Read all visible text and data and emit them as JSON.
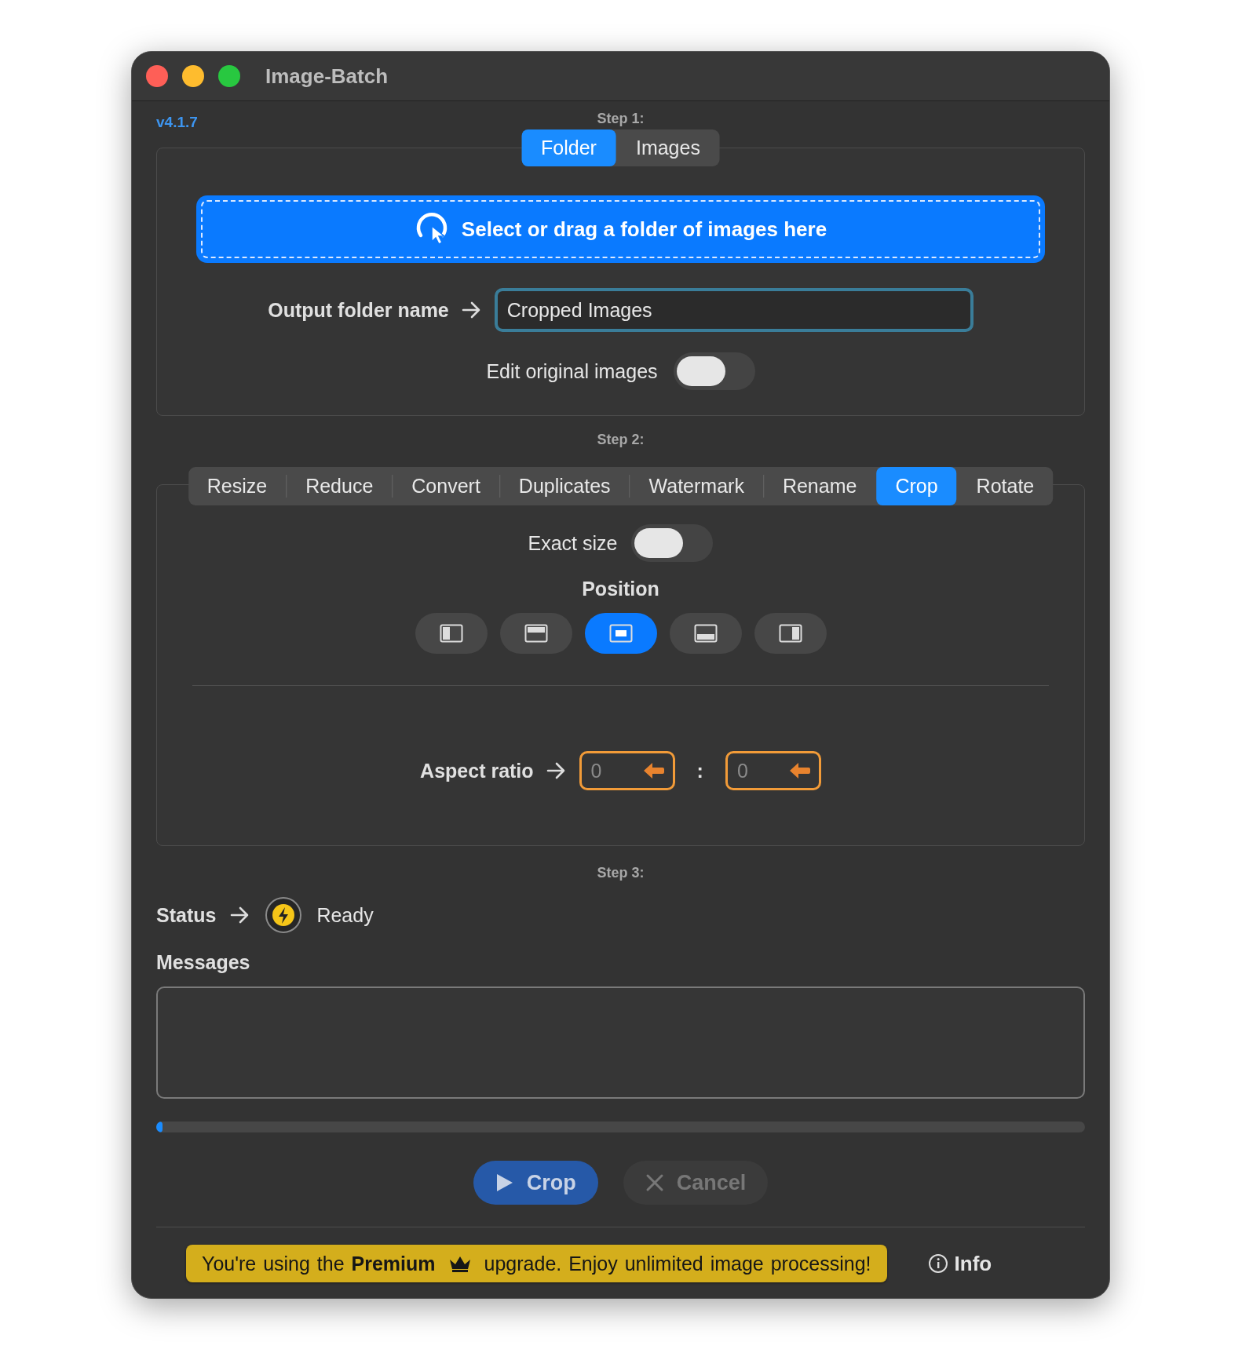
{
  "window": {
    "title": "Image-Batch"
  },
  "version": "v4.1.7",
  "step1": {
    "label": "Step 1:",
    "source_tabs": [
      {
        "label": "Folder",
        "selected": true
      },
      {
        "label": "Images",
        "selected": false
      }
    ],
    "drop_zone": "Select or drag a folder of images here",
    "output_label": "Output folder name",
    "output_value": "Cropped Images",
    "edit_original": {
      "label": "Edit original images",
      "on": false
    }
  },
  "step2": {
    "label": "Step 2:",
    "tabs": [
      {
        "label": "Resize",
        "selected": false
      },
      {
        "label": "Reduce",
        "selected": false
      },
      {
        "label": "Convert",
        "selected": false
      },
      {
        "label": "Duplicates",
        "selected": false
      },
      {
        "label": "Watermark",
        "selected": false
      },
      {
        "label": "Rename",
        "selected": false
      },
      {
        "label": "Crop",
        "selected": true
      },
      {
        "label": "Rotate",
        "selected": false
      }
    ],
    "exact_size": {
      "label": "Exact size",
      "on": false
    },
    "position_label": "Position",
    "positions": [
      {
        "kind": "left",
        "selected": false
      },
      {
        "kind": "top",
        "selected": false
      },
      {
        "kind": "center",
        "selected": true
      },
      {
        "kind": "bottom",
        "selected": false
      },
      {
        "kind": "right",
        "selected": false
      }
    ],
    "aspect_label": "Aspect ratio",
    "aspect_fields": [
      {
        "placeholder": "0"
      },
      {
        "placeholder": "0"
      }
    ],
    "aspect_separator": ":"
  },
  "step3": {
    "label": "Step 3:",
    "status_label": "Status",
    "status": "Ready",
    "messages_label": "Messages",
    "progress": {
      "level": 0.005
    },
    "buttons": [
      {
        "kind": "run",
        "label": "Crop",
        "disabled": true
      },
      {
        "kind": "cancel",
        "label": "Cancel",
        "disabled": true
      }
    ]
  },
  "footer": {
    "banner_prefix": "You're using the **Premium**",
    "banner_suffix": "upgrade. Enjoy unlimited image processing!",
    "info": "Info"
  }
}
